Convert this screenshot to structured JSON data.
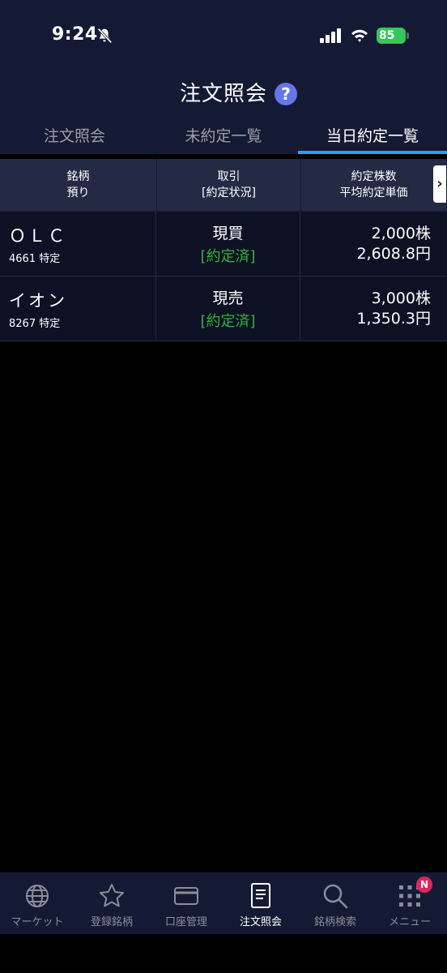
{
  "status": {
    "time": "9:24",
    "battery": "85"
  },
  "header": {
    "title": "注文照会"
  },
  "tabs": [
    {
      "label": "注文照会"
    },
    {
      "label": "未約定一覧"
    },
    {
      "label": "当日約定一覧"
    }
  ],
  "table": {
    "headers": {
      "col1_line1": "銘柄",
      "col1_line2": "預り",
      "col2_line1": "取引",
      "col2_line2": "[約定状況]",
      "col3_line1": "約定株数",
      "col3_line2": "平均約定単価"
    },
    "rows": [
      {
        "name": "ＯＬＣ",
        "code": "4661 特定",
        "trade": "現買",
        "status": "[約定済]",
        "qty": "2,000株",
        "price": "2,608.8円"
      },
      {
        "name": "イオン",
        "code": "8267 特定",
        "trade": "現売",
        "status": "[約定済]",
        "qty": "3,000株",
        "price": "1,350.3円"
      }
    ]
  },
  "nav": {
    "items": [
      {
        "label": "マーケット"
      },
      {
        "label": "登録銘柄"
      },
      {
        "label": "口座管理"
      },
      {
        "label": "注文照会"
      },
      {
        "label": "銘柄検索"
      },
      {
        "label": "メニュー"
      }
    ],
    "badge": "N"
  },
  "colors": {
    "accent": "#2a9df4",
    "executed": "#2fb53a",
    "header_bg": "#151a34",
    "help": "#6476e8",
    "badge": "#e0245e"
  }
}
